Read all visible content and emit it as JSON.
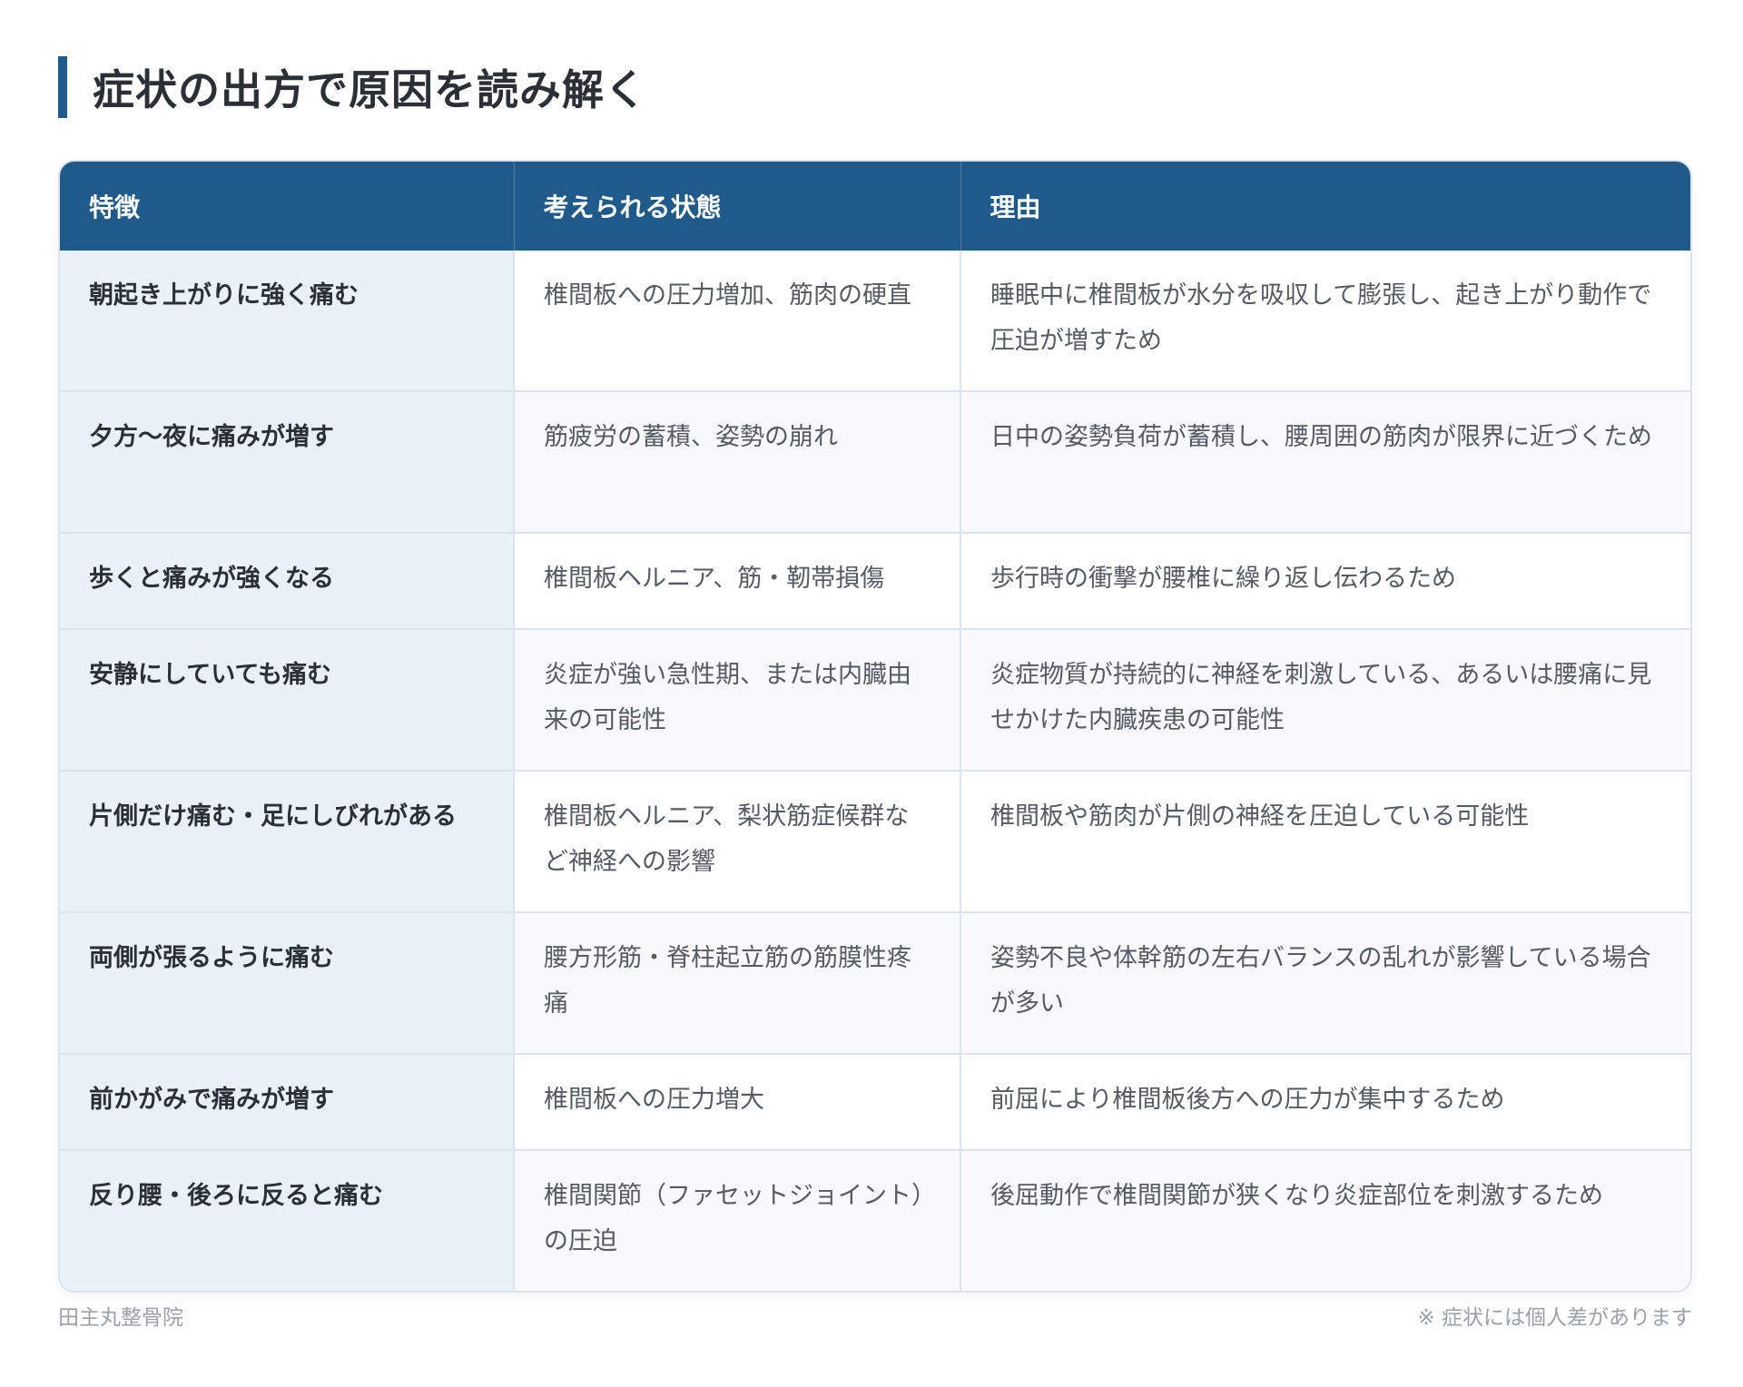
{
  "page": {
    "title": "症状の出方で原因を読み解く"
  },
  "table": {
    "headers": [
      "特徴",
      "考えられる状態",
      "理由"
    ],
    "rows": [
      {
        "feature": "朝起き上がりに強く痛む",
        "condition": "椎間板への圧力増加、筋肉の硬直",
        "reason": "睡眠中に椎間板が水分を吸収して膨張し、起き上がり動作で圧迫が増すため"
      },
      {
        "feature": "夕方〜夜に痛みが増す",
        "condition": "筋疲労の蓄積、姿勢の崩れ",
        "reason": "日中の姿勢負荷が蓄積し、腰周囲の筋肉が限界に近づくため"
      },
      {
        "feature": "歩くと痛みが強くなる",
        "condition": "椎間板ヘルニア、筋・靭帯損傷",
        "reason": "歩行時の衝撃が腰椎に繰り返し伝わるため"
      },
      {
        "feature": "安静にしていても痛む",
        "condition": "炎症が強い急性期、または内臓由来の可能性",
        "reason": "炎症物質が持続的に神経を刺激している、あるいは腰痛に見せかけた内臓疾患の可能性"
      },
      {
        "feature": "片側だけ痛む・足にしびれがある",
        "condition": "椎間板ヘルニア、梨状筋症候群など神経への影響",
        "reason": "椎間板や筋肉が片側の神経を圧迫している可能性"
      },
      {
        "feature": "両側が張るように痛む",
        "condition": "腰方形筋・脊柱起立筋の筋膜性疼痛",
        "reason": "姿勢不良や体幹筋の左右バランスの乱れが影響している場合が多い"
      },
      {
        "feature": "前かがみで痛みが増す",
        "condition": "椎間板への圧力増大",
        "reason": "前屈により椎間板後方への圧力が集中するため"
      },
      {
        "feature": "反り腰・後ろに反ると痛む",
        "condition": "椎間関節（ファセットジョイント）の圧迫",
        "reason": "後屈動作で椎間関節が狭くなり炎症部位を刺激するため"
      }
    ]
  },
  "footer": {
    "clinic": "田主丸整骨院",
    "note": "※ 症状には個人差があります"
  },
  "colors": {
    "accent": "#1f5a8a",
    "feature_bg": "#eaf2f9",
    "border": "#dbe3ec"
  }
}
